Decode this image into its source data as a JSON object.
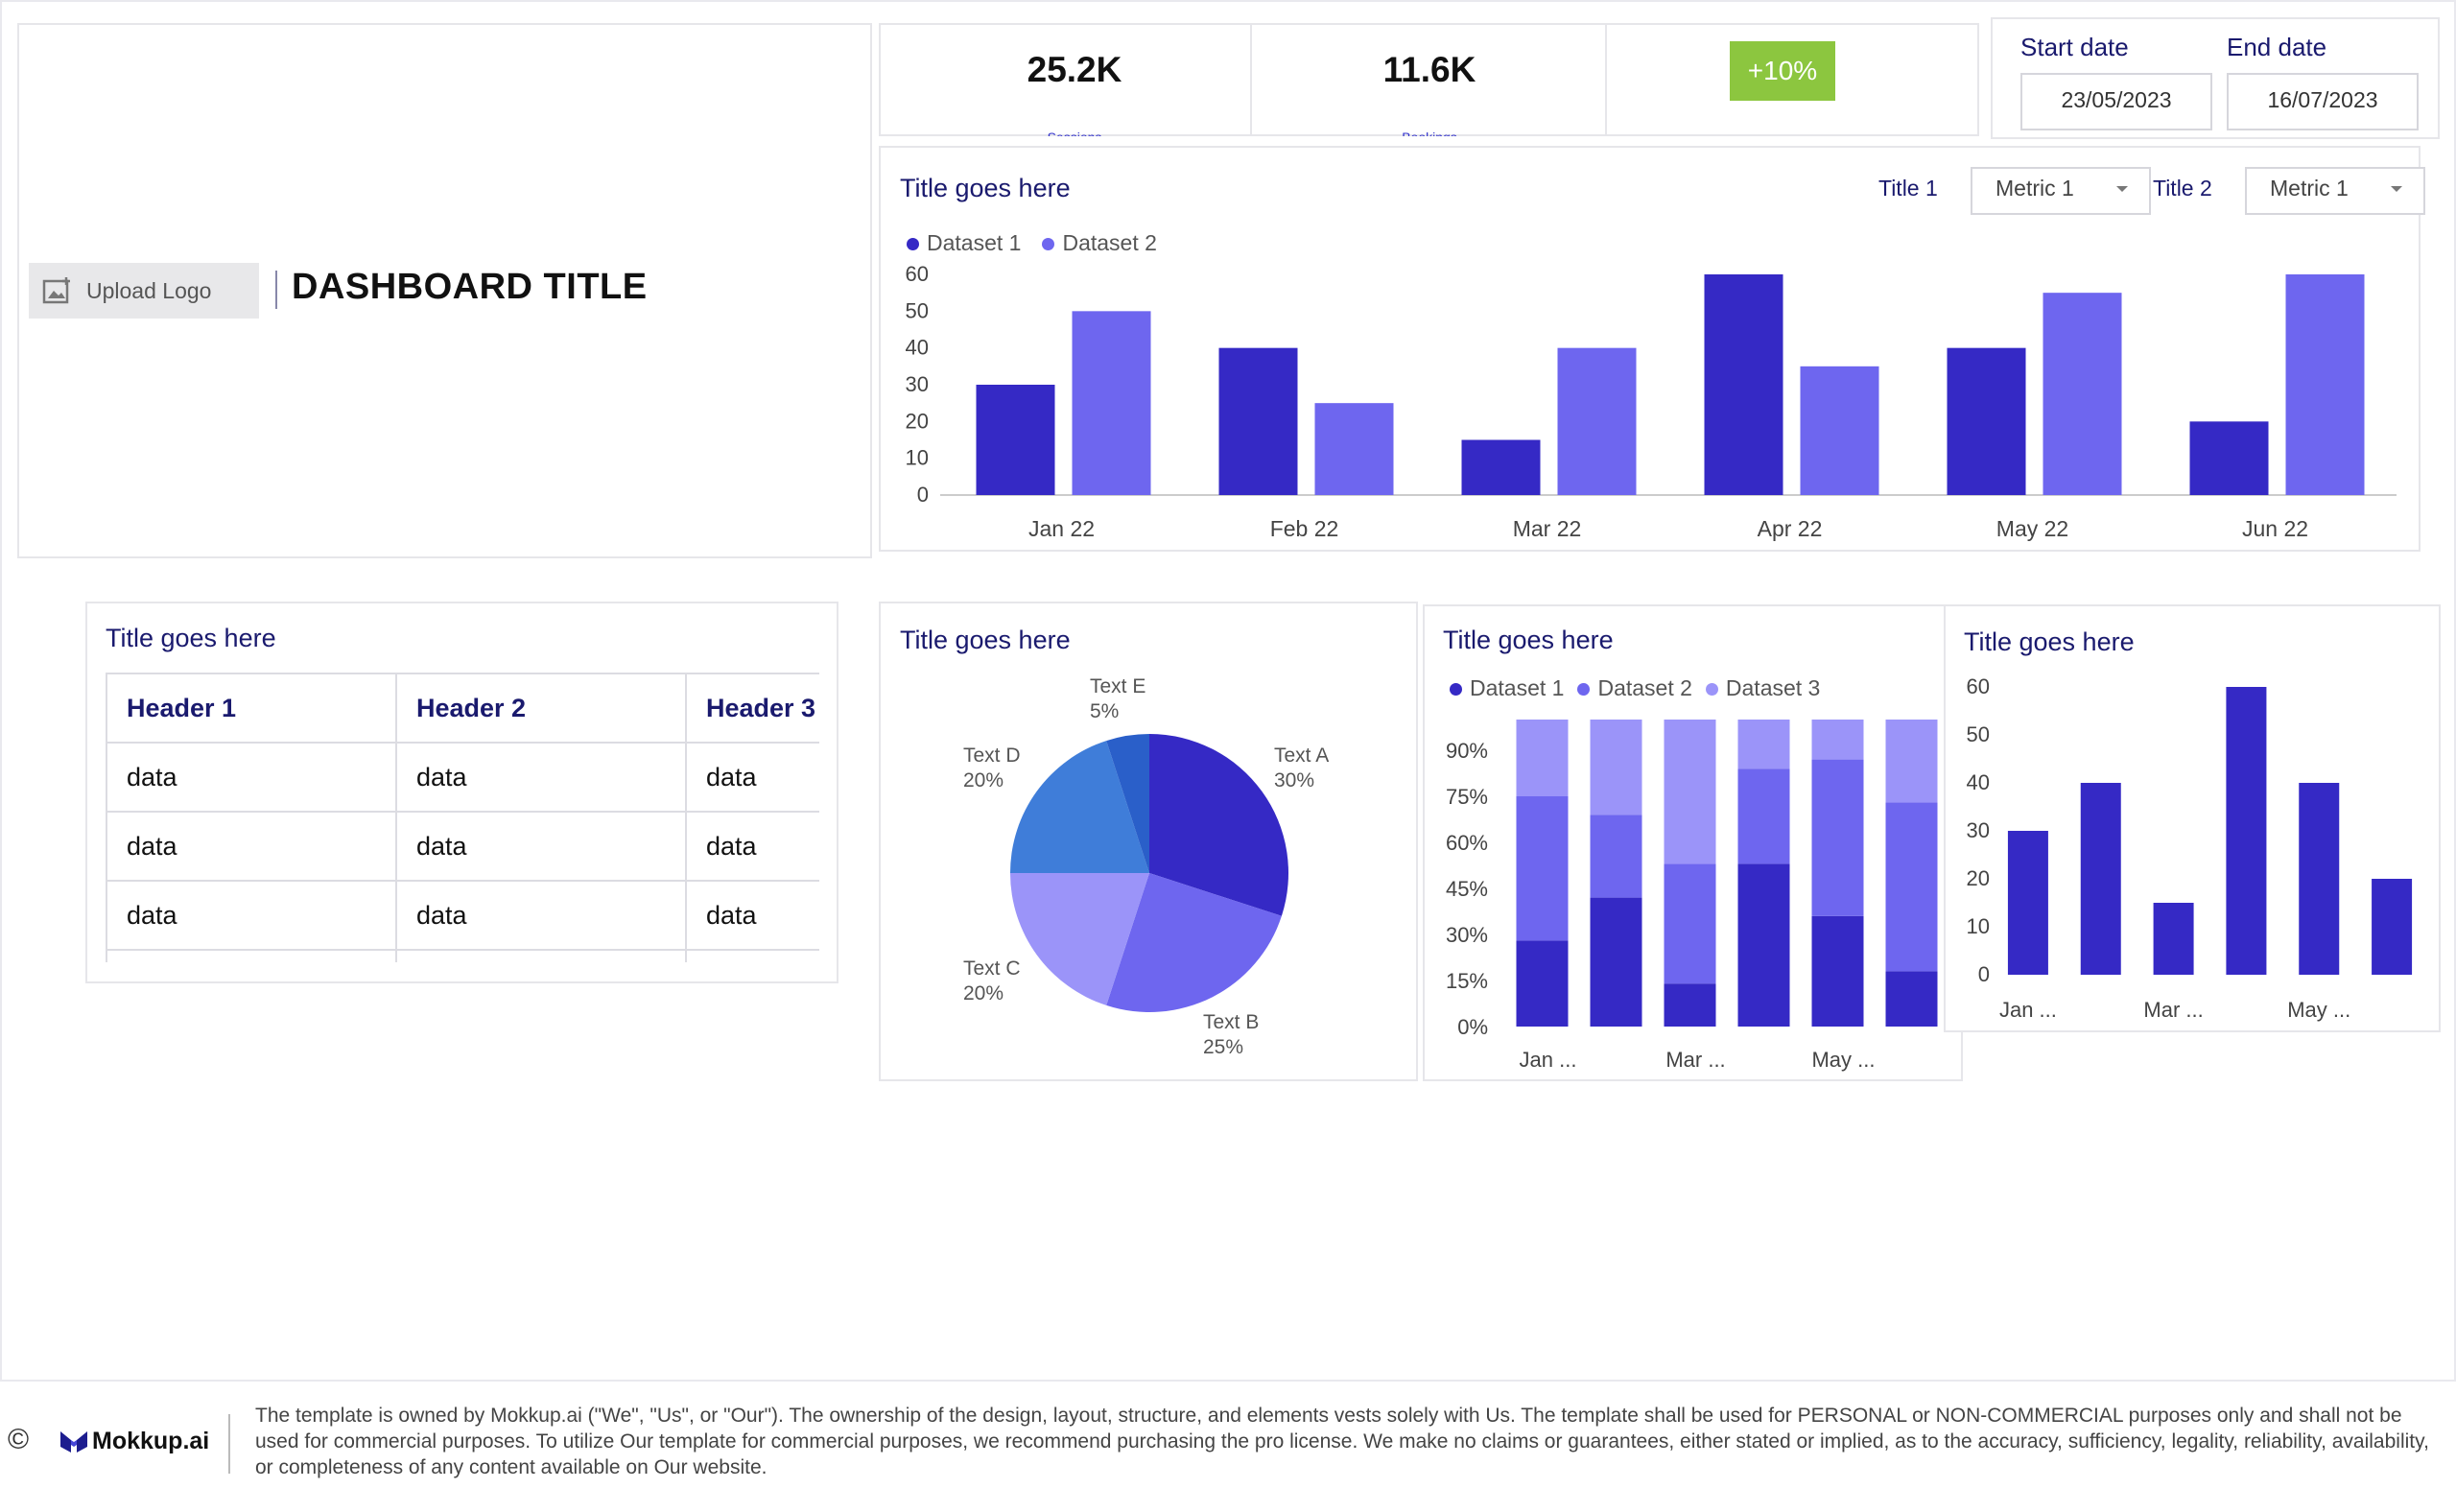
{
  "header": {
    "upload_logo_label": "Upload Logo",
    "dashboard_title": "DASHBOARD TITLE"
  },
  "kpis": [
    {
      "value": "25.2K",
      "label": "Sessions"
    },
    {
      "value": "11.6K",
      "label": "Bookings"
    }
  ],
  "kpi_badge": "+10%",
  "dates": {
    "start_label": "Start date",
    "start_value": "23/05/2023",
    "end_label": "End date",
    "end_value": "16/07/2023"
  },
  "main_chart": {
    "title": "Title goes here",
    "control1_title": "Title 1",
    "control1_value": "Metric 1",
    "control2_title": "Title 2",
    "control2_value": "Metric 1",
    "legend": [
      "Dataset 1",
      "Dataset 2"
    ]
  },
  "table_panel": {
    "title": "Title goes here",
    "headers": [
      "Header 1",
      "Header 2",
      "Header 3"
    ],
    "rows": [
      [
        "data",
        "data",
        "data"
      ],
      [
        "data",
        "data",
        "data"
      ],
      [
        "data",
        "data",
        "data"
      ]
    ]
  },
  "pie_panel": {
    "title": "Title goes here"
  },
  "stacked_panel": {
    "title": "Title goes here",
    "legend": [
      "Dataset 1",
      "Dataset 2",
      "Dataset 3"
    ]
  },
  "small_bar_panel": {
    "title": "Title goes here"
  },
  "colors": {
    "dataset1": "#3529c5",
    "dataset2": "#6e66ef",
    "dataset3": "#9b94f9",
    "pie_d": "#3f7dd9",
    "pie_e": "#2a5fc9",
    "badge": "#8cc63f",
    "title_navy": "#1a1a6e"
  },
  "footer": {
    "copyright_symbol": "©",
    "brand": "Mokkup.ai",
    "disclaimer": "The template is owned by Mokkup.ai (\"We\", \"Us\", or \"Our\"). The ownership of the design, layout, structure, and elements vests solely with Us. The template shall be used for PERSONAL or NON-COMMERCIAL purposes only and shall not be used for commercial purposes. To utilize Our template for commercial purposes, we recommend purchasing the pro license. We make no claims or guarantees, either stated or implied, as to the accuracy, sufficiency, legality, reliability, availability, or completeness of any content available on Our website."
  },
  "chart_data": [
    {
      "type": "bar",
      "categories": [
        "Jan 22",
        "Feb 22",
        "Mar 22",
        "Apr 22",
        "May 22",
        "Jun 22"
      ],
      "series": [
        {
          "name": "Dataset 1",
          "values": [
            30,
            40,
            15,
            60,
            40,
            20
          ]
        },
        {
          "name": "Dataset 2",
          "values": [
            50,
            25,
            40,
            35,
            55,
            60
          ]
        }
      ],
      "yticks": [
        0,
        10,
        20,
        30,
        40,
        50,
        60
      ],
      "ylim": [
        0,
        60
      ],
      "legend": "top-left"
    },
    {
      "type": "pie",
      "slices": [
        {
          "label": "Text A",
          "value": 30,
          "display": "30%"
        },
        {
          "label": "Text B",
          "value": 25,
          "display": "25%"
        },
        {
          "label": "Text C",
          "value": 20,
          "display": "20%"
        },
        {
          "label": "Text D",
          "value": 20,
          "display": "20%"
        },
        {
          "label": "Text E",
          "value": 5,
          "display": "5%"
        }
      ]
    },
    {
      "type": "bar",
      "stacked": true,
      "categories": [
        "Jan ...",
        "",
        "Mar ...",
        "",
        "May ...",
        ""
      ],
      "series": [
        {
          "name": "Dataset 1",
          "values": [
            28,
            42,
            14,
            53,
            36,
            18
          ]
        },
        {
          "name": "Dataset 2",
          "values": [
            47,
            27,
            39,
            31,
            51,
            55
          ]
        },
        {
          "name": "Dataset 3",
          "values": [
            25,
            31,
            47,
            16,
            13,
            27
          ]
        }
      ],
      "yticks": [
        "0%",
        "15%",
        "30%",
        "45%",
        "60%",
        "75%",
        "90%"
      ],
      "ylim": [
        0,
        100
      ],
      "legend": "top-left"
    },
    {
      "type": "bar",
      "categories": [
        "Jan ...",
        "",
        "Mar ...",
        "",
        "May ...",
        ""
      ],
      "values": [
        30,
        40,
        15,
        60,
        40,
        20
      ],
      "yticks": [
        0,
        10,
        20,
        30,
        40,
        50,
        60
      ],
      "ylim": [
        0,
        60
      ]
    }
  ]
}
